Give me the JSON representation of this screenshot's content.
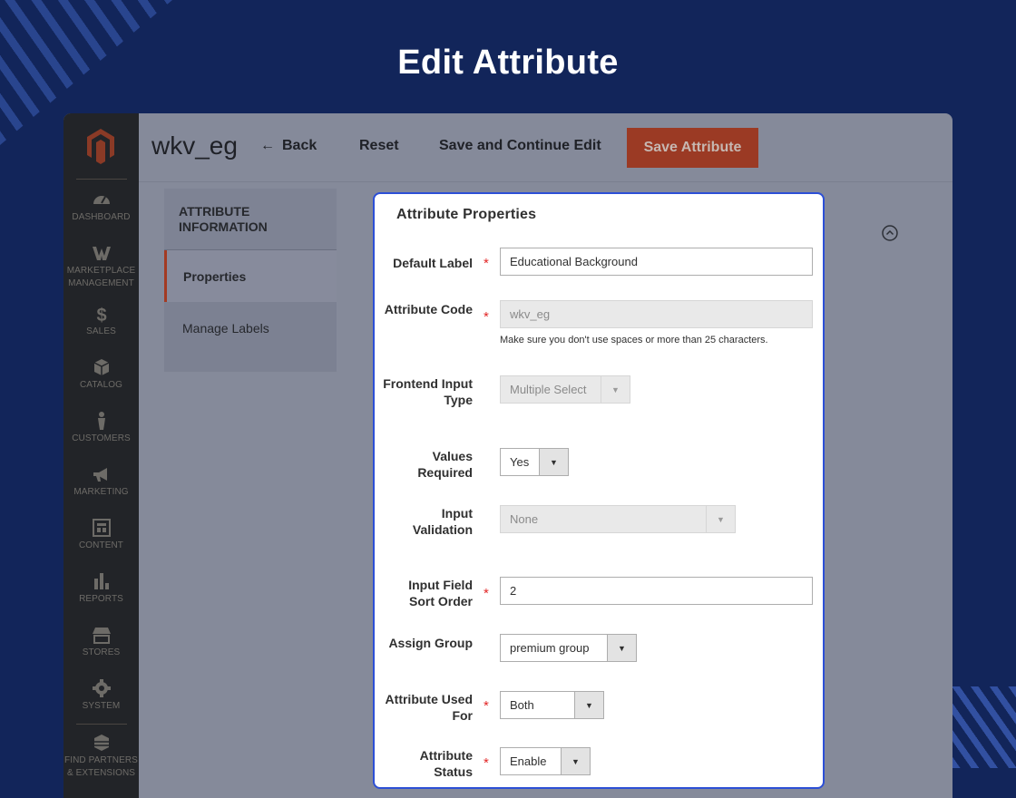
{
  "heading": "Edit Attribute",
  "sidebar": {
    "logo": "magento-logo",
    "items": [
      {
        "label": "DASHBOARD",
        "icon": "dashboard-icon"
      },
      {
        "label": "MARKETPLACE MANAGEMENT",
        "icon": "marketplace-icon"
      },
      {
        "label": "SALES",
        "icon": "dollar-icon"
      },
      {
        "label": "CATALOG",
        "icon": "cube-icon"
      },
      {
        "label": "CUSTOMERS",
        "icon": "person-icon"
      },
      {
        "label": "MARKETING",
        "icon": "megaphone-icon"
      },
      {
        "label": "CONTENT",
        "icon": "content-icon"
      },
      {
        "label": "REPORTS",
        "icon": "bar-chart-icon"
      },
      {
        "label": "STORES",
        "icon": "store-icon"
      },
      {
        "label": "SYSTEM",
        "icon": "gear-icon"
      },
      {
        "label": "FIND PARTNERS & EXTENSIONS",
        "icon": "partners-icon"
      }
    ]
  },
  "toolbar": {
    "record_title": "wkv_eg",
    "back_arrow": "←",
    "back_label": "Back",
    "reset_label": "Reset",
    "save_continue_label": "Save and Continue Edit",
    "save_label": "Save Attribute"
  },
  "tabs": {
    "heading": "ATTRIBUTE INFORMATION",
    "items": [
      "Properties",
      "Manage Labels"
    ]
  },
  "form": {
    "title": "Attribute Properties",
    "required_marker": "*",
    "default_label": {
      "label": "Default Label",
      "value": "Educational Background"
    },
    "attribute_code": {
      "label": "Attribute Code",
      "value": "wkv_eg",
      "note": "Make sure you don't use spaces or more than 25 characters."
    },
    "frontend_input_type": {
      "label": "Frontend Input Type",
      "value": "Multiple Select"
    },
    "values_required": {
      "label": "Values Required",
      "value": "Yes"
    },
    "input_validation": {
      "label": "Input Validation",
      "value": "None"
    },
    "sort_order": {
      "label": "Input Field Sort Order",
      "value": "2"
    },
    "assign_group": {
      "label": "Assign Group",
      "value": "premium group"
    },
    "used_for": {
      "label": "Attribute Used For",
      "value": "Both"
    },
    "status": {
      "label": "Attribute Status",
      "value": "Enable"
    },
    "caret": "▼"
  },
  "colors": {
    "background": "#12255a",
    "accent_button": "#9b3a24",
    "panel_border": "#2c4fd6",
    "required": "#e22626"
  }
}
